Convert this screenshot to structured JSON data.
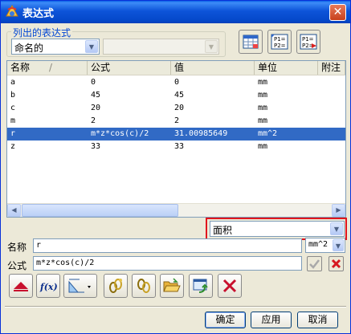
{
  "window": {
    "title": "表达式"
  },
  "list_group": {
    "label": "列出的表达式",
    "filter_value": "命名的",
    "second_value": ""
  },
  "table": {
    "columns": [
      "名称",
      "公式",
      "值",
      "单位",
      "附注"
    ],
    "sort_indicator": "/",
    "rows": [
      {
        "name": "a",
        "formula": "0",
        "value": "0",
        "unit": "mm"
      },
      {
        "name": "b",
        "formula": "45",
        "value": "45",
        "unit": "mm"
      },
      {
        "name": "c",
        "formula": "20",
        "value": "20",
        "unit": "mm"
      },
      {
        "name": "m",
        "formula": "2",
        "value": "2",
        "unit": "mm"
      },
      {
        "name": "r",
        "formula": "m*z*cos(c)/2",
        "value": "31.00985649",
        "unit": "mm^2"
      },
      {
        "name": "z",
        "formula": "33",
        "value": "33",
        "unit": "mm"
      }
    ],
    "selected_row": 4
  },
  "type_select": {
    "value": "面积"
  },
  "name_field": {
    "label": "名称",
    "value": "r",
    "unit": "mm^2"
  },
  "formula_field": {
    "label": "公式",
    "value": "m*z*cos(c)/2"
  },
  "buttons": {
    "ok": "确定",
    "apply": "应用",
    "cancel": "取消"
  },
  "icons": [
    "spreadsheet-icon",
    "list-to-text-icon",
    "list-export-icon",
    "up-triangle-icon",
    "function-icon",
    "measure-icon",
    "link-chain-icon",
    "relationship-icon",
    "open-folder-icon",
    "refresh-icon",
    "delete-x-icon"
  ],
  "colors": {
    "selection": "#316AC5",
    "highlight_box": "#E1151D",
    "titlebar": "#0D54D9"
  }
}
